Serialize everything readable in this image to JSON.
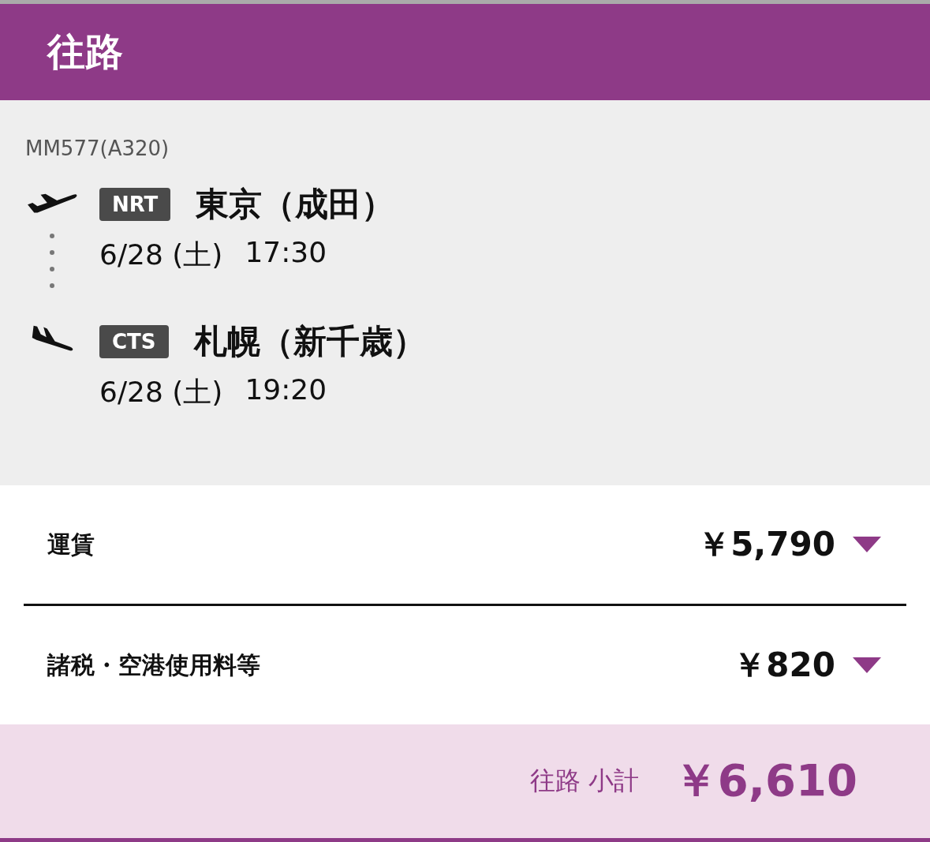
{
  "header": {
    "title": "往路"
  },
  "flight": {
    "number": "MM577(A320)",
    "segments": [
      {
        "kind": "departure",
        "code": "NRT",
        "airport": "東京（成田）",
        "date": "6/28 (土)",
        "time": "17:30"
      },
      {
        "kind": "arrival",
        "code": "CTS",
        "airport": "札幌（新千歳）",
        "date": "6/28 (土)",
        "time": "19:20"
      }
    ]
  },
  "fares": [
    {
      "label": "運賃",
      "amount": "￥5,790",
      "expanded": false
    },
    {
      "label": "諸税・空港使用料等",
      "amount": "￥820",
      "expanded": false
    }
  ],
  "subtotal": {
    "label": "往路 小計",
    "amount": "￥6,610"
  }
}
